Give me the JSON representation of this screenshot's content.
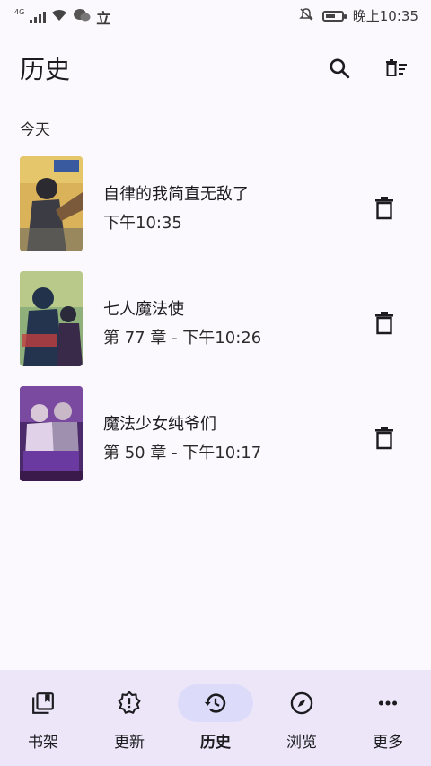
{
  "status_bar": {
    "network": "4G",
    "app_icon_text": "立",
    "time": "晚上10:35"
  },
  "header": {
    "title": "历史",
    "search_icon": "search-icon",
    "clear_icon": "delete-sweep-icon"
  },
  "section": {
    "label": "今天"
  },
  "items": [
    {
      "title": "自律的我简直无敌了",
      "subtitle": "下午10:35"
    },
    {
      "title": "七人魔法使",
      "subtitle": "第 77 章 - 下午10:26"
    },
    {
      "title": "魔法少女纯爷们",
      "subtitle": "第 50 章 - 下午10:17"
    }
  ],
  "nav": [
    {
      "label": "书架",
      "icon": "library-icon"
    },
    {
      "label": "更新",
      "icon": "updates-icon"
    },
    {
      "label": "历史",
      "icon": "history-icon",
      "active": true
    },
    {
      "label": "浏览",
      "icon": "compass-icon"
    },
    {
      "label": "更多",
      "icon": "more-icon"
    }
  ],
  "colors": {
    "background": "#fcf9fe",
    "nav_background": "#ece6f8",
    "nav_active_pill": "#dcdcfa"
  }
}
